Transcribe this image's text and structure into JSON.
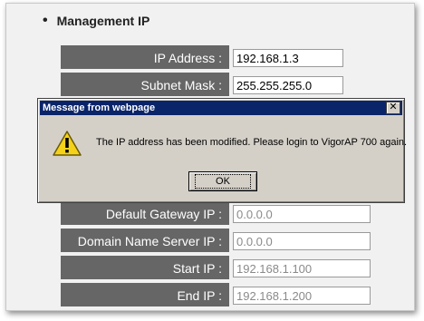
{
  "section": {
    "title": "Management IP"
  },
  "rows": [
    {
      "label": "IP Address :",
      "value": "192.168.1.3"
    },
    {
      "label": "Subnet Mask :",
      "value": "255.255.255.0"
    },
    {
      "label": "Default Gateway IP :",
      "value": "0.0.0.0"
    },
    {
      "label": "Domain Name Server IP :",
      "value": "0.0.0.0"
    },
    {
      "label": "Start IP :",
      "value": "192.168.1.100"
    },
    {
      "label": "End IP :",
      "value": "192.168.1.200"
    }
  ],
  "dialog": {
    "title": "Message from webpage",
    "close_label": "✕",
    "message": "The IP address has been modified. Please login to VigorAP 700 again.",
    "ok_label": "OK",
    "icon": "warning-icon"
  },
  "colors": {
    "label_bg": "#666666",
    "titlebar_bg": "#0a246a",
    "dialog_bg": "#d4d0c8"
  }
}
